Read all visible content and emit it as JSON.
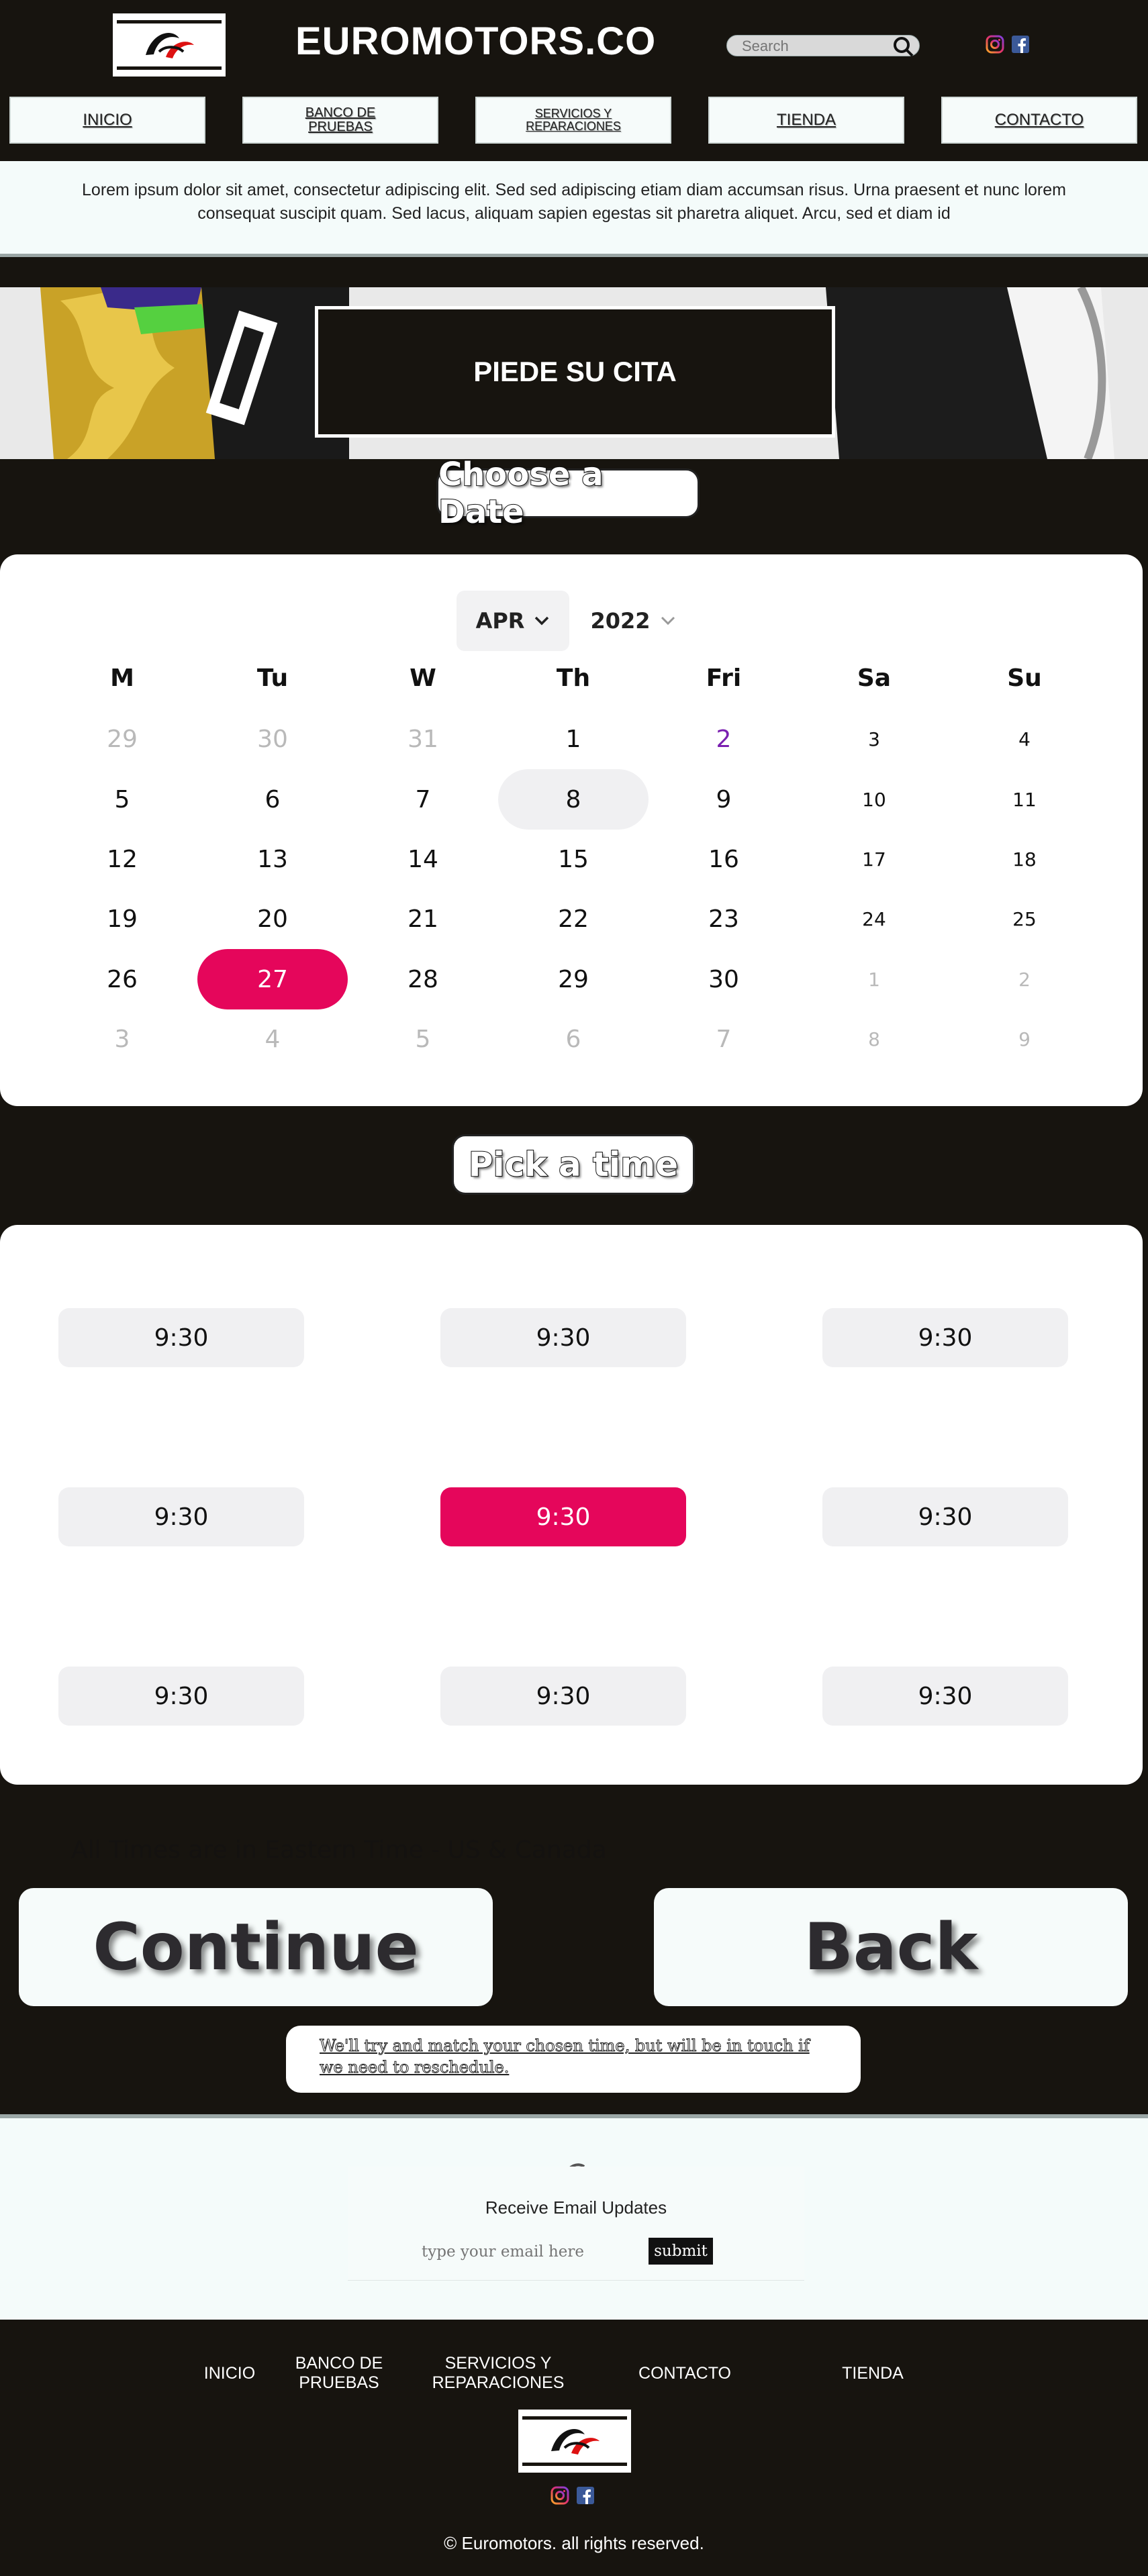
{
  "header": {
    "brand": "EUROMOTORS.CO",
    "search": {
      "placeholder": "Search"
    },
    "nav": [
      {
        "label": "INICIO"
      },
      {
        "label": "BANCO DE PRUEBAS"
      },
      {
        "label": "SERVICIOS Y REPARACIONES"
      },
      {
        "label": "TIENDA"
      },
      {
        "label": "CONTACTO"
      }
    ],
    "social_icons": [
      "instagram-icon",
      "facebook-icon"
    ]
  },
  "intro": {
    "text": "Lorem ipsum dolor sit amet, consectetur adipiscing elit. Sed sed adipiscing etiam diam accumsan risus. Urna praesent et nunc lorem consequat suscipit quam. Sed lacus, aliquam sapien egestas sit pharetra aliquet. Arcu, sed et diam id"
  },
  "hero": {
    "cta": "PIEDE SU CITA"
  },
  "date_section": {
    "title": "Choose a Date",
    "month": "APR",
    "year": "2022",
    "weekdays": [
      "M",
      "Tu",
      "W",
      "Th",
      "Fri",
      "Sa",
      "Su"
    ],
    "weeks": [
      [
        "29",
        "30",
        "31",
        "1",
        "2",
        "3",
        "4"
      ],
      [
        "5",
        "6",
        "7",
        "8",
        "9",
        "10",
        "11"
      ],
      [
        "12",
        "13",
        "14",
        "15",
        "16",
        "17",
        "18"
      ],
      [
        "19",
        "20",
        "21",
        "22",
        "23",
        "24",
        "25"
      ],
      [
        "26",
        "27",
        "28",
        "29",
        "30",
        "1",
        "2"
      ],
      [
        "3",
        "4",
        "5",
        "6",
        "7",
        "8",
        "9"
      ]
    ],
    "today": "8",
    "selected": "27"
  },
  "time_section": {
    "title": "Pick a time",
    "slots": [
      "9:30",
      "9:30",
      "9:30",
      "9:30",
      "9:30",
      "9:30",
      "9:30",
      "9:30",
      "9:30"
    ],
    "selected_index": 4,
    "timezone_note": "All Times are in Eastern Time - US & Canada"
  },
  "actions": {
    "continue": "Continue",
    "back": "Back",
    "notice": "We'll try and match your chosen time, but will be in touch if we need to reschedule."
  },
  "newsletter": {
    "title": "Receive Email Updates",
    "input_placeholder": "type your email here",
    "submit": "submit"
  },
  "footer": {
    "links": [
      {
        "label": "INICIO"
      },
      {
        "label": "BANCO DE PRUEBAS"
      },
      {
        "label": "SERVICIOS Y REPARACIONES"
      },
      {
        "label": "CONTACTO"
      },
      {
        "label": "TIENDA"
      }
    ],
    "copyright": "© Euromotors. all rights reserved."
  },
  "colors": {
    "accent": "#e5065b",
    "dark": "#17140f",
    "light": "#f4fbfa"
  }
}
